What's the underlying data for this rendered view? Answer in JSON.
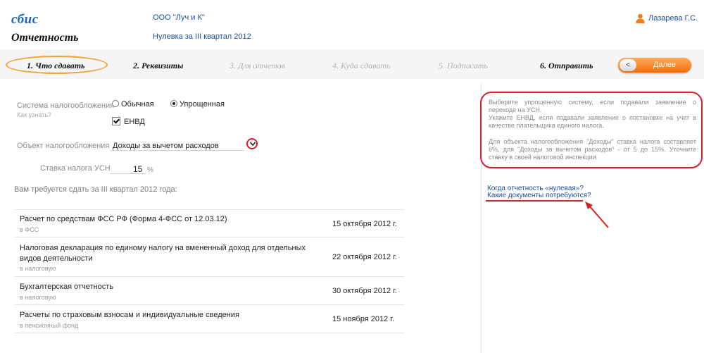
{
  "header": {
    "logo": "сбис",
    "section_title": "Отчетность",
    "organization": "ООО \"Луч и К\"",
    "period": "Нулевка за III квартал 2012",
    "user_name": "Лазарева Г.С."
  },
  "steps": [
    {
      "label": "1. Что сдавать",
      "state": "active"
    },
    {
      "label": "2. Реквизиты",
      "state": "enabled"
    },
    {
      "label": "3. Для отчетов",
      "state": "disabled"
    },
    {
      "label": "4. Куда сдавать",
      "state": "disabled"
    },
    {
      "label": "5. Подписать",
      "state": "disabled"
    },
    {
      "label": "6. Отправить",
      "state": "enabled"
    }
  ],
  "next_button": {
    "knob": "<",
    "label": "Далее"
  },
  "form": {
    "tax_system_label": "Система налогообложения",
    "tax_system_hint": "Как узнать?",
    "tax_system_options": [
      "Обычная",
      "Упрощенная"
    ],
    "tax_system_selected": "Упрощенная",
    "envd_label": "ЕНВД",
    "envd_checked": true,
    "object_label": "Объект налогообложения",
    "object_value": "Доходы за вычетом расходов",
    "rate_label": "Ставка налога УСН",
    "rate_value": "15",
    "rate_unit": "%",
    "required_title": "Вам требуется сдать за III квартал 2012 года:"
  },
  "reports": [
    {
      "title": "Расчет по средствам ФСС РФ (Форма 4-ФСС от 12.03.12)",
      "dest": "в ФСС",
      "date": "15 октября 2012 г."
    },
    {
      "title": "Налоговая декларация по единому налогу на вмененный доход для отдельных видов деятельности",
      "dest": "в налоговую",
      "date": "22 октября 2012 г."
    },
    {
      "title": "Бухгалтерская отчетность",
      "dest": "в налоговую",
      "date": "30 октября 2012 г."
    },
    {
      "title": "Расчеты по страховым взносам и индивидуальные сведения",
      "dest": "в пенсионный фонд",
      "date": "15 ноября 2012 г."
    }
  ],
  "info": {
    "p1": "Выберите упрощенную систему, если подавали заявление о переходе на УСН.",
    "p2": "Укажите ЕНВД, если подавали заявление о постановке на учет в качестве плательщика единого налога.",
    "p3": "Для объекта налогообложения \"Доходы\" ставка налога составляет 6%, для \"Доходы за вычетом расходов\" - от 5 до 15%. Уточните ставку в своей налоговой инспекции."
  },
  "links": {
    "zero_report": "Когда отчетность «нулевая»?",
    "documents": "Какие документы потребуются?"
  },
  "colors": {
    "accent": "#f46f0a",
    "link": "#1a4d99",
    "annotation": "#d21f2b",
    "step_highlight": "#f0a238"
  }
}
